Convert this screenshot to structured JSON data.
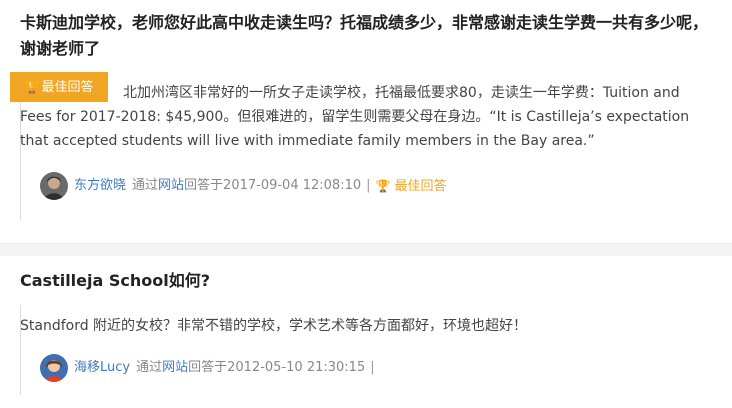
{
  "questions": [
    {
      "title": "卡斯迪加学校，老师您好此高中收走读生吗？托福成绩多少，非常感谢走读生学费一共有多少呢，谢谢老师了",
      "best_badge_label": "最佳回答",
      "answer_text": "北加州湾区非常好的一所女子走读学校，托福最低要求80，走读生一年学费：Tuition and Fees for 2017-2018: $45,900。但很难进的，留学生则需要父母在身边。“It is Castilleja’s expectation that accepted students will live with immediate family members in the Bay area.”",
      "user": "东方欲晓",
      "via_prefix": "通过",
      "via_site": "网站",
      "answered_at": "回答于2017-09-04 12:08:10",
      "separator": "|",
      "best_tag": "最佳回答"
    },
    {
      "title": "Castilleja School如何?",
      "answer_text": "Standford 附近的女校？非常不错的学校，学术艺术等各方面都好，环境也超好！",
      "user": "海移Lucy",
      "via_prefix": "通过",
      "via_site": "网站",
      "answered_at": "回答于2012-05-10 21:30:15",
      "separator": "|"
    }
  ],
  "icons": {
    "trophy": "trophy-icon"
  },
  "colors": {
    "accent": "#f0a523",
    "link": "#3b7dc4"
  }
}
